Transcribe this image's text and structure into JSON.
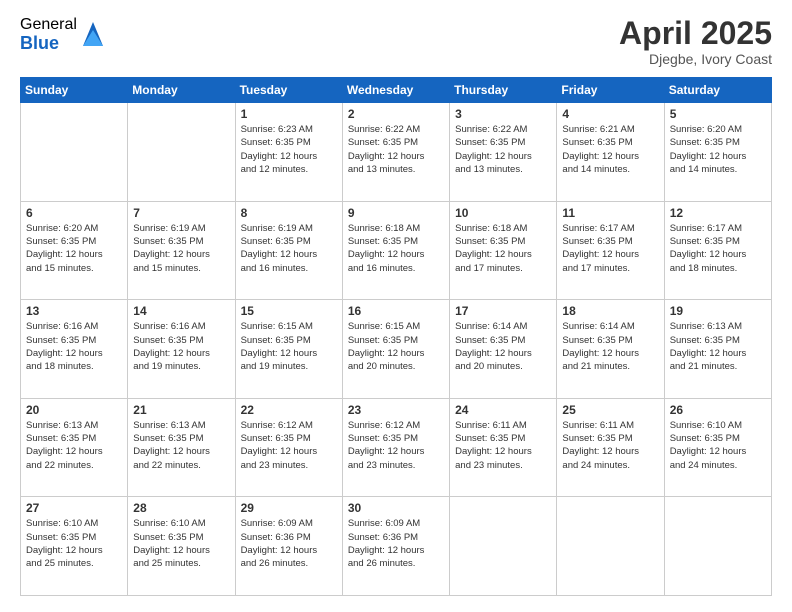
{
  "header": {
    "logo_general": "General",
    "logo_blue": "Blue",
    "title": "April 2025",
    "location": "Djegbe, Ivory Coast"
  },
  "days_of_week": [
    "Sunday",
    "Monday",
    "Tuesday",
    "Wednesday",
    "Thursday",
    "Friday",
    "Saturday"
  ],
  "weeks": [
    [
      {
        "num": "",
        "info": ""
      },
      {
        "num": "",
        "info": ""
      },
      {
        "num": "1",
        "info": "Sunrise: 6:23 AM\nSunset: 6:35 PM\nDaylight: 12 hours\nand 12 minutes."
      },
      {
        "num": "2",
        "info": "Sunrise: 6:22 AM\nSunset: 6:35 PM\nDaylight: 12 hours\nand 13 minutes."
      },
      {
        "num": "3",
        "info": "Sunrise: 6:22 AM\nSunset: 6:35 PM\nDaylight: 12 hours\nand 13 minutes."
      },
      {
        "num": "4",
        "info": "Sunrise: 6:21 AM\nSunset: 6:35 PM\nDaylight: 12 hours\nand 14 minutes."
      },
      {
        "num": "5",
        "info": "Sunrise: 6:20 AM\nSunset: 6:35 PM\nDaylight: 12 hours\nand 14 minutes."
      }
    ],
    [
      {
        "num": "6",
        "info": "Sunrise: 6:20 AM\nSunset: 6:35 PM\nDaylight: 12 hours\nand 15 minutes."
      },
      {
        "num": "7",
        "info": "Sunrise: 6:19 AM\nSunset: 6:35 PM\nDaylight: 12 hours\nand 15 minutes."
      },
      {
        "num": "8",
        "info": "Sunrise: 6:19 AM\nSunset: 6:35 PM\nDaylight: 12 hours\nand 16 minutes."
      },
      {
        "num": "9",
        "info": "Sunrise: 6:18 AM\nSunset: 6:35 PM\nDaylight: 12 hours\nand 16 minutes."
      },
      {
        "num": "10",
        "info": "Sunrise: 6:18 AM\nSunset: 6:35 PM\nDaylight: 12 hours\nand 17 minutes."
      },
      {
        "num": "11",
        "info": "Sunrise: 6:17 AM\nSunset: 6:35 PM\nDaylight: 12 hours\nand 17 minutes."
      },
      {
        "num": "12",
        "info": "Sunrise: 6:17 AM\nSunset: 6:35 PM\nDaylight: 12 hours\nand 18 minutes."
      }
    ],
    [
      {
        "num": "13",
        "info": "Sunrise: 6:16 AM\nSunset: 6:35 PM\nDaylight: 12 hours\nand 18 minutes."
      },
      {
        "num": "14",
        "info": "Sunrise: 6:16 AM\nSunset: 6:35 PM\nDaylight: 12 hours\nand 19 minutes."
      },
      {
        "num": "15",
        "info": "Sunrise: 6:15 AM\nSunset: 6:35 PM\nDaylight: 12 hours\nand 19 minutes."
      },
      {
        "num": "16",
        "info": "Sunrise: 6:15 AM\nSunset: 6:35 PM\nDaylight: 12 hours\nand 20 minutes."
      },
      {
        "num": "17",
        "info": "Sunrise: 6:14 AM\nSunset: 6:35 PM\nDaylight: 12 hours\nand 20 minutes."
      },
      {
        "num": "18",
        "info": "Sunrise: 6:14 AM\nSunset: 6:35 PM\nDaylight: 12 hours\nand 21 minutes."
      },
      {
        "num": "19",
        "info": "Sunrise: 6:13 AM\nSunset: 6:35 PM\nDaylight: 12 hours\nand 21 minutes."
      }
    ],
    [
      {
        "num": "20",
        "info": "Sunrise: 6:13 AM\nSunset: 6:35 PM\nDaylight: 12 hours\nand 22 minutes."
      },
      {
        "num": "21",
        "info": "Sunrise: 6:13 AM\nSunset: 6:35 PM\nDaylight: 12 hours\nand 22 minutes."
      },
      {
        "num": "22",
        "info": "Sunrise: 6:12 AM\nSunset: 6:35 PM\nDaylight: 12 hours\nand 23 minutes."
      },
      {
        "num": "23",
        "info": "Sunrise: 6:12 AM\nSunset: 6:35 PM\nDaylight: 12 hours\nand 23 minutes."
      },
      {
        "num": "24",
        "info": "Sunrise: 6:11 AM\nSunset: 6:35 PM\nDaylight: 12 hours\nand 23 minutes."
      },
      {
        "num": "25",
        "info": "Sunrise: 6:11 AM\nSunset: 6:35 PM\nDaylight: 12 hours\nand 24 minutes."
      },
      {
        "num": "26",
        "info": "Sunrise: 6:10 AM\nSunset: 6:35 PM\nDaylight: 12 hours\nand 24 minutes."
      }
    ],
    [
      {
        "num": "27",
        "info": "Sunrise: 6:10 AM\nSunset: 6:35 PM\nDaylight: 12 hours\nand 25 minutes."
      },
      {
        "num": "28",
        "info": "Sunrise: 6:10 AM\nSunset: 6:35 PM\nDaylight: 12 hours\nand 25 minutes."
      },
      {
        "num": "29",
        "info": "Sunrise: 6:09 AM\nSunset: 6:36 PM\nDaylight: 12 hours\nand 26 minutes."
      },
      {
        "num": "30",
        "info": "Sunrise: 6:09 AM\nSunset: 6:36 PM\nDaylight: 12 hours\nand 26 minutes."
      },
      {
        "num": "",
        "info": ""
      },
      {
        "num": "",
        "info": ""
      },
      {
        "num": "",
        "info": ""
      }
    ]
  ]
}
